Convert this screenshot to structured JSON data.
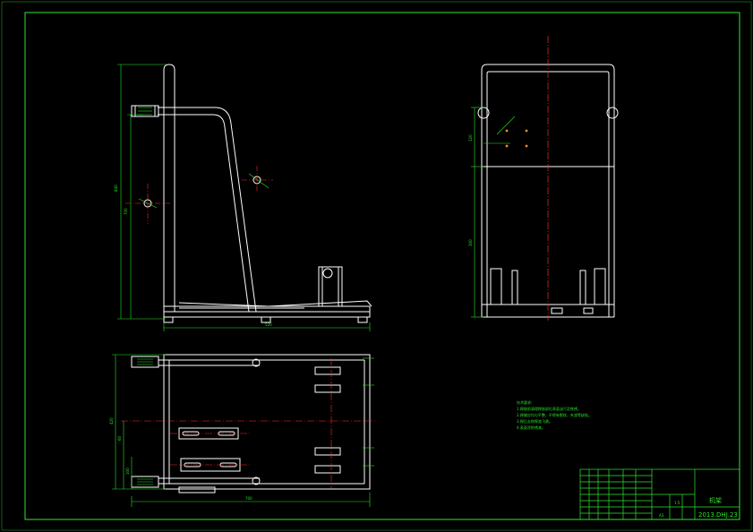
{
  "drawing": {
    "background": "#000000",
    "colors": {
      "frame": "#2ee62e",
      "outline": "#ffffff",
      "center_line": "#ff2a2a",
      "dimension": "#29e329"
    }
  },
  "title_block": {
    "drawing_name": "机架",
    "drawing_number": "2013.DHJ.23",
    "scale_label": "1:5",
    "material_label": "A3"
  },
  "tech_notes": {
    "heading": "技术要求:",
    "lines": [
      "1.焊接前清理焊接部位表面油污及铁锈。",
      "2.焊缝应均匀平整，不得有裂纹、夹渣等缺陷。",
      "3.焊后去除焊渣飞溅。",
      "4.表面涂防锈漆。"
    ]
  },
  "dimensions": {
    "front_height": "840",
    "front_sub_height": "700",
    "front_bottom_width": "520",
    "side_height_upper": "120",
    "side_height_lower": "300",
    "plan_width": "700",
    "plan_depth": "420",
    "plan_offset_1": "60",
    "plan_offset_2": "100"
  }
}
